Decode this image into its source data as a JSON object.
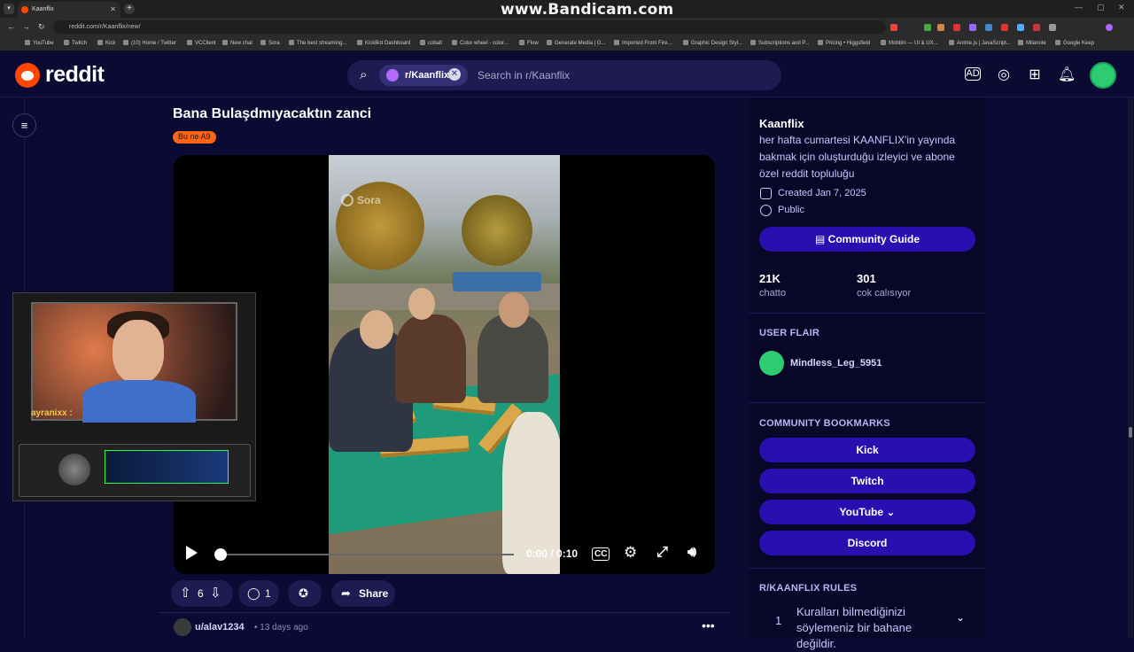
{
  "browser": {
    "tab_title": "Kaanflix",
    "url": "reddit.com/r/Kaanflix/new/",
    "watermark": "www.Bandicam.com",
    "bookmarks": [
      "YouTube",
      "Twitch",
      "Kick",
      "(10) Home / Twitter",
      "VCClient",
      "New chat",
      "Sora",
      "The best streaming...",
      "KickBot Dashboard",
      "cobalt",
      "Color wheel - color...",
      "Flow",
      "Generate Media | G...",
      "Imported From Fire...",
      "Graphic Design Styl...",
      "Subscriptions and P...",
      "Pricing • Higgsfield",
      "Mobbin — UI & UX...",
      "Anime.js | JavaScript...",
      "Milanote",
      "Google Keep"
    ]
  },
  "header": {
    "logo_text": "reddit",
    "search_chip": "r/Kaanflix",
    "search_placeholder": "Search in r/Kaanflix",
    "icons": [
      "ad-icon",
      "chat-icon",
      "create-icon",
      "notifications-icon"
    ]
  },
  "post": {
    "title": "Bana Bulaşdmıyacaktın zanci",
    "flair": "Bu ne A9",
    "video_watermark": "Sora",
    "video_time": "0:00 / 0:10",
    "progress": 0,
    "votes": "6",
    "comments": "1",
    "share_label": "Share"
  },
  "comment": {
    "user": "u/alav1234",
    "time": "13 days ago"
  },
  "sidebar": {
    "name": "Kaanflix",
    "description": "her hafta cumartesi KAANFLIX'in yayında bakmak için oluşturduğu izleyici ve abone özel reddit topluluğu",
    "created": "Created Jan 7, 2025",
    "visibility": "Public",
    "guide_button": "Community Guide",
    "stats": [
      {
        "value": "21K",
        "label": "chatto"
      },
      {
        "value": "301",
        "label": "cok calısıyor"
      }
    ],
    "user_flair_heading": "USER FLAIR",
    "user_flair_name": "Mindless_Leg_5951",
    "bookmarks_heading": "COMMUNITY BOOKMARKS",
    "bookmarks": [
      "Kick",
      "Twitch",
      "YouTube",
      "Discord"
    ],
    "rules_heading": "R/KAANFLIX RULES",
    "rules": [
      {
        "num": "1",
        "text": "Kuralları bilmediğinizi söylemeniz bir bahane değildir."
      }
    ]
  },
  "stream_overlay": {
    "chat_user": "ayranixx :"
  },
  "colors": {
    "background": "#0b0a33",
    "accent": "#ff4500",
    "button": "#2a0fb0",
    "flair": "#ff6314"
  }
}
